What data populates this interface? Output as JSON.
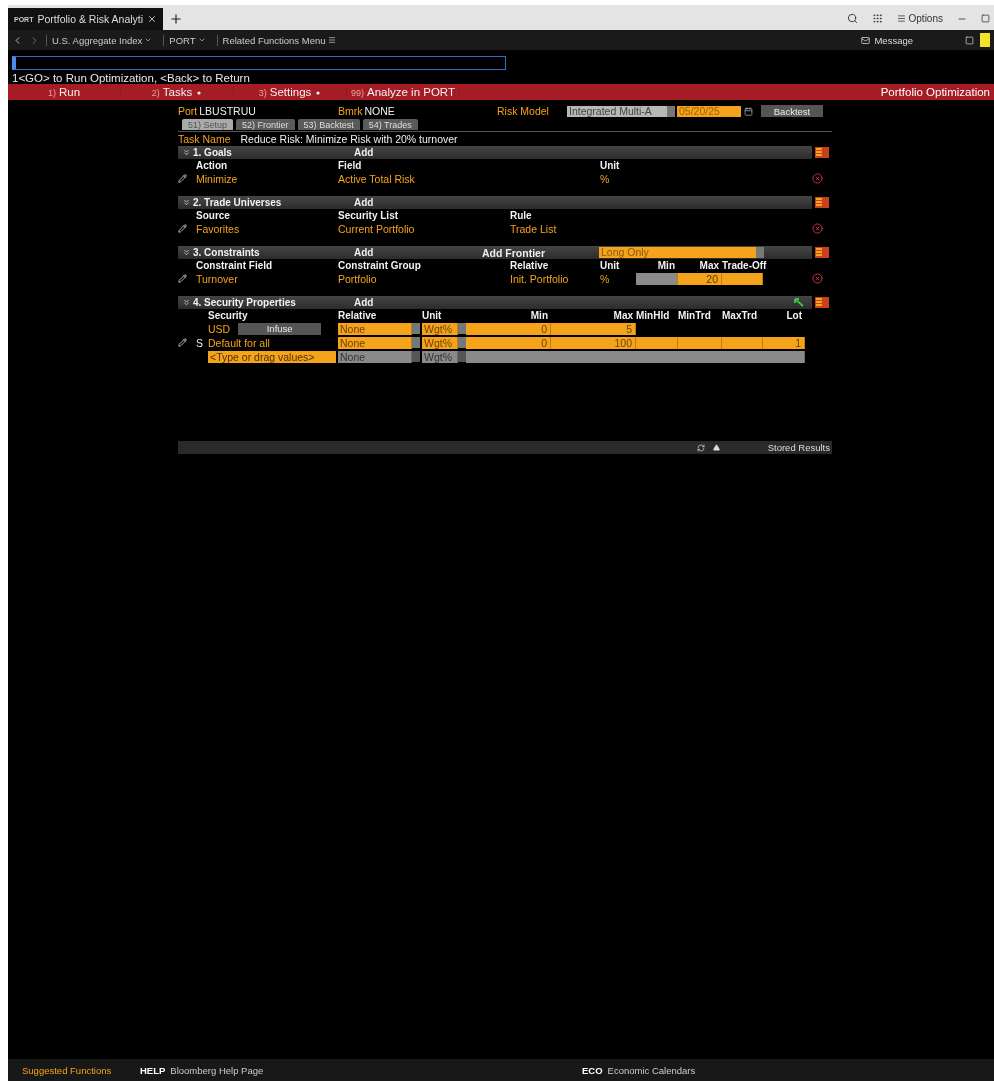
{
  "title_bar": {
    "tab": {
      "code": "PORT",
      "title": "Portfolio & Risk Analyti",
      "selected": true
    },
    "options": "Options"
  },
  "nav_bar": {
    "crumbs": [
      {
        "label": "U.S. Aggregate Index",
        "kind": "dropdown"
      },
      {
        "label": "PORT",
        "kind": "dropdown"
      },
      {
        "label": "Related Functions Menu",
        "kind": "menu"
      }
    ],
    "message": "Message"
  },
  "message": "1<GO> to Run Optimization, <Back> to Return",
  "menu_bar": {
    "items": [
      {
        "number": "1)",
        "label": "Run",
        "dropdown": false
      },
      {
        "number": "2)",
        "label": "Tasks",
        "dropdown": true
      },
      {
        "number": "3)",
        "label": "Settings",
        "dropdown": true
      },
      {
        "number": "99)",
        "label": "Analyze in PORT",
        "dropdown": false
      }
    ],
    "title": "Portfolio Optimization"
  },
  "panel": {
    "port": {
      "label": "Port",
      "value": "LBUSTRUU"
    },
    "bmrk": {
      "label": "Bmrk",
      "value": "NONE"
    },
    "risk_model": {
      "label": "Risk Model",
      "value": "Integrated Multi-A"
    },
    "date": "05/20/25",
    "backtest_button": "Backtest",
    "tabs": [
      {
        "number": "51)",
        "label": "Setup",
        "selected": true
      },
      {
        "number": "52)",
        "label": "Frontier",
        "selected": false
      },
      {
        "number": "53)",
        "label": "Backtest",
        "selected": false
      },
      {
        "number": "54)",
        "label": "Trades",
        "selected": false
      }
    ],
    "task": {
      "label": "Task Name",
      "value": "Reduce Risk: Minimize Risk with 20% turnover"
    }
  },
  "sections": [
    {
      "kind": "basic",
      "title": "1. Goals",
      "add": "Add",
      "columns": {
        "col1": "Action",
        "col2": "Field",
        "unit": "Unit"
      },
      "rows": [
        {
          "col1": "Minimize",
          "col2": "Active Total Risk",
          "unit": "%"
        }
      ]
    },
    {
      "kind": "basic",
      "title": "2. Trade Universes",
      "add": "Add",
      "columns": {
        "col1": "Source",
        "col2": "Security List",
        "col3": "Rule"
      },
      "rows": [
        {
          "col1": "Favorites",
          "col2": "Current Portfolio",
          "col3": "Trade List"
        }
      ]
    },
    {
      "kind": "basic",
      "title": "3. Constraints",
      "add": "Add",
      "frontier": {
        "label": "Add Frontier",
        "value": "Long Only"
      },
      "columns": {
        "col1": "Constraint Field",
        "col2": "Constraint Group",
        "col3": "Relative",
        "unit": "Unit",
        "min": "Min",
        "max": "Max",
        "tradeoff": "Trade-Off"
      },
      "rows": [
        {
          "col1": "Turnover",
          "col2": "Portfolio",
          "col3": "Init. Portfolio",
          "unit": "%",
          "inputs": {
            "min": {
              "enabled": false
            },
            "max": {
              "enabled": true,
              "value": "20"
            },
            "tradeoff": {
              "enabled": true
            }
          }
        }
      ]
    },
    {
      "kind": "properties",
      "title": "4. Security Properties",
      "add": "Add",
      "columns": {
        "security": "Security",
        "relative": "Relative",
        "unit": "Unit",
        "min": "Min",
        "max": "Max",
        "minhld": "MinHld",
        "mintrd": "MinTrd",
        "maxtrd": "MaxTrd",
        "lot": "Lot"
      },
      "rows": [
        {
          "security": "USD",
          "infuse": "Infuse",
          "enabled": true,
          "extended": false,
          "relative": "None",
          "unit": "Wgt%",
          "min": "0",
          "max": "5"
        },
        {
          "flag": "S",
          "security": "Default for all",
          "editable": true,
          "enabled": true,
          "extended": true,
          "relative": "None",
          "unit": "Wgt%",
          "min": "0",
          "max": "100",
          "lot": "1"
        },
        {
          "security": "<Type or drag values>",
          "entry": true,
          "enabled": false,
          "extended": true,
          "relative": "None",
          "unit": "Wgt%"
        }
      ]
    }
  ],
  "results_bar": {
    "label": "Stored Results"
  },
  "footer": {
    "suggested": "Suggested Functions",
    "links": [
      {
        "code": "HELP",
        "label": "Bloomberg Help Page"
      },
      {
        "code": "ECO",
        "label": "Economic Calendars"
      }
    ]
  }
}
